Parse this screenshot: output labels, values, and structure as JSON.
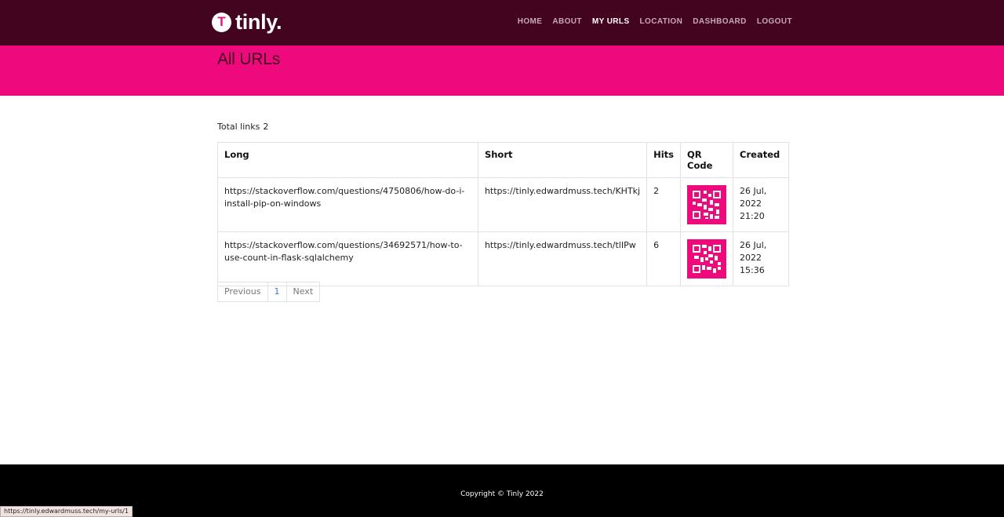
{
  "brand": {
    "badge_letter": "T",
    "name": "tinly."
  },
  "nav": {
    "items": [
      {
        "label": "HOME"
      },
      {
        "label": "ABOUT"
      },
      {
        "label": "MY URLS"
      },
      {
        "label": "LOCATION"
      },
      {
        "label": "DASHBOARD"
      },
      {
        "label": "LOGOUT"
      }
    ],
    "active": "MY URLS"
  },
  "page": {
    "title": "All URLs"
  },
  "summary": {
    "label": "Total links",
    "count": "2"
  },
  "table": {
    "headers": [
      "Long",
      "Short",
      "Hits",
      "QR Code",
      "Created"
    ],
    "rows": [
      {
        "long": "https://stackoverflow.com/questions/4750806/how-do-i-install-pip-on-windows",
        "short": "https://tinly.edwardmuss.tech/KHTkj",
        "hits": "2",
        "created": "26 Jul, 2022 21:20"
      },
      {
        "long": "https://stackoverflow.com/questions/34692571/how-to-use-count-in-flask-sqlalchemy",
        "short": "https://tinly.edwardmuss.tech/tlIPw",
        "hits": "6",
        "created": "26 Jul, 2022 15:36"
      }
    ]
  },
  "pagination": {
    "previous": "Previous",
    "current": "1",
    "next": "Next"
  },
  "footer": {
    "copyright": "Copyright © Tinly 2022"
  },
  "status_bar": {
    "url": "https://tinly.edwardmuss.tech/my-urls/1"
  },
  "colors": {
    "navbar": "#43041f",
    "accent": "#ee0a7c",
    "link": "#2f7fd1",
    "footer": "#000000"
  }
}
